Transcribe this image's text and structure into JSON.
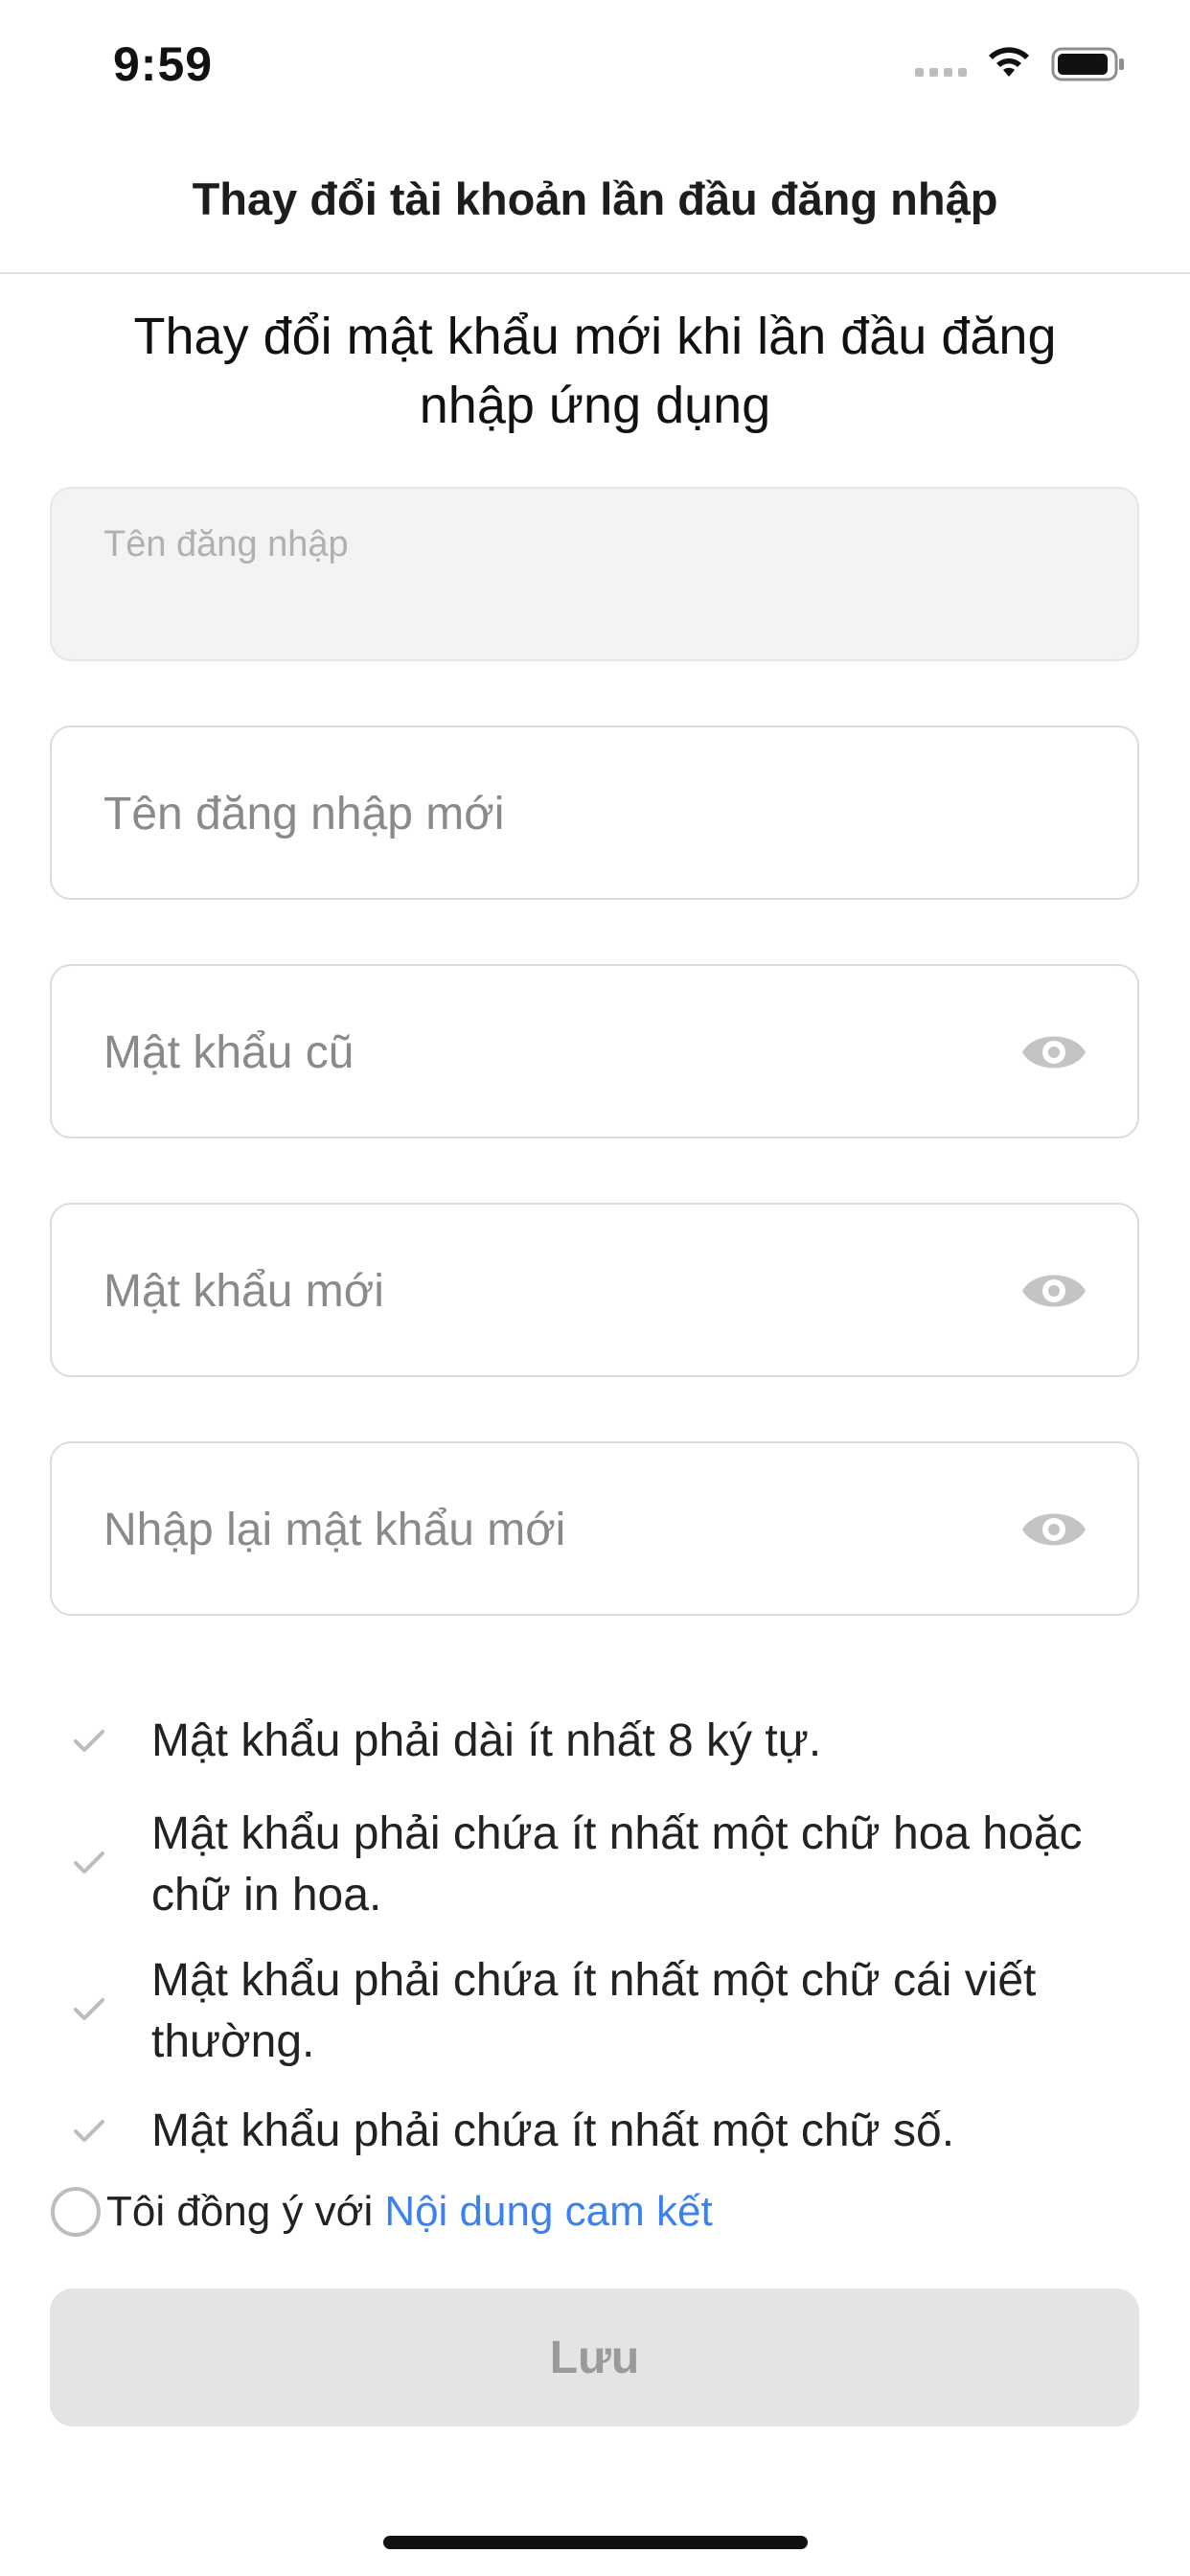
{
  "status_bar": {
    "time": "9:59",
    "icons": [
      "signal-icon",
      "wifi-icon",
      "battery-icon"
    ]
  },
  "header": {
    "title": "Thay đổi tài khoản lần đầu đăng nhập"
  },
  "main": {
    "heading": "Thay đổi mật khẩu mới khi lần đầu đăng nhập ứng dụng",
    "fields": {
      "username": {
        "placeholder": "Tên đăng nhập",
        "value": ""
      },
      "new_username": {
        "placeholder": "Tên đăng nhập mới",
        "value": ""
      },
      "old_password": {
        "placeholder": "Mật khẩu cũ",
        "value": ""
      },
      "new_password": {
        "placeholder": "Mật khẩu mới",
        "value": ""
      },
      "confirm_password": {
        "placeholder": "Nhập lại mật khẩu mới",
        "value": ""
      }
    },
    "rules": [
      {
        "text": "Mật khẩu phải dài ít nhất 8 ký tự."
      },
      {
        "text": "Mật khẩu phải chứa ít nhất một chữ hoa hoặc chữ in hoa."
      },
      {
        "text": "Mật khẩu phải chứa ít nhất một chữ cái viết thường."
      },
      {
        "text": "Mật khẩu phải chứa ít nhất một chữ số."
      }
    ],
    "agreement": {
      "label": "Tôi đồng ý với",
      "link": "Nội dung cam kết",
      "checked": false
    },
    "save_label": "Lưu"
  },
  "colors": {
    "accent_link": "#3b82f0",
    "button_disabled_bg": "#e4e4e6",
    "button_disabled_text": "#9a9a9a",
    "icon_gray": "#bdbdbd"
  }
}
